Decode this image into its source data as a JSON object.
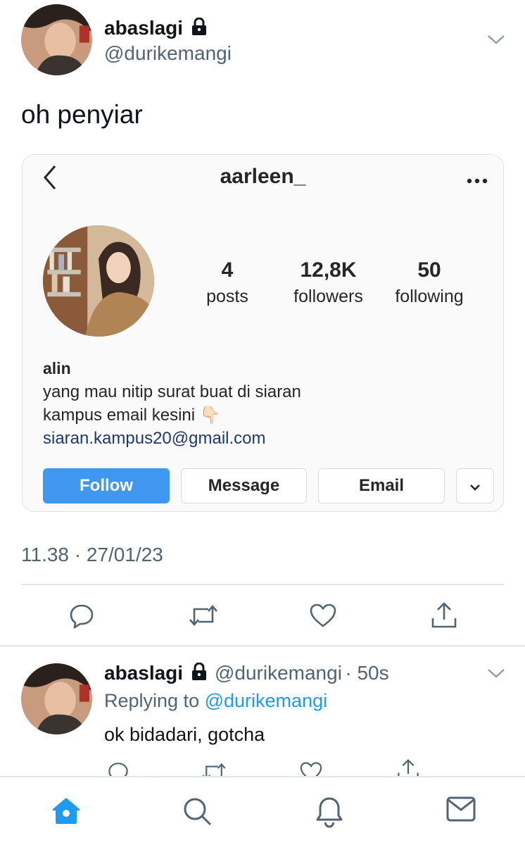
{
  "tweet": {
    "author_name": "abaslagi",
    "author_handle": "@durikemangi",
    "text": "oh penyiar",
    "timestamp": "11.38 · 27/01/23"
  },
  "embedded_profile": {
    "username": "aarleen_",
    "stats": [
      {
        "value": "4",
        "label": "posts"
      },
      {
        "value": "12,8K",
        "label": "followers"
      },
      {
        "value": "50",
        "label": "following"
      }
    ],
    "bio_name": "alin",
    "bio_line1": "yang mau nitip surat buat di siaran",
    "bio_line2": "kampus email kesini 👇🏻",
    "bio_link": "siaran.kampus20@gmail.com",
    "buttons": {
      "follow": "Follow",
      "message": "Message",
      "email": "Email"
    }
  },
  "reply": {
    "author_name": "abaslagi",
    "author_handle": "@durikemangi",
    "age": "· 50s",
    "replying_prefix": "Replying to",
    "replying_handle": "@durikemangi",
    "text": "ok bidadari, gotcha"
  },
  "colors": {
    "accent": "#1d9bf0",
    "ig_follow": "#3f97f0",
    "muted": "#536471"
  },
  "icons": {
    "actions": [
      "reply-icon",
      "retweet-icon",
      "like-icon",
      "share-icon"
    ],
    "tabs": [
      "home-icon",
      "search-icon",
      "notifications-icon",
      "messages-icon"
    ]
  }
}
